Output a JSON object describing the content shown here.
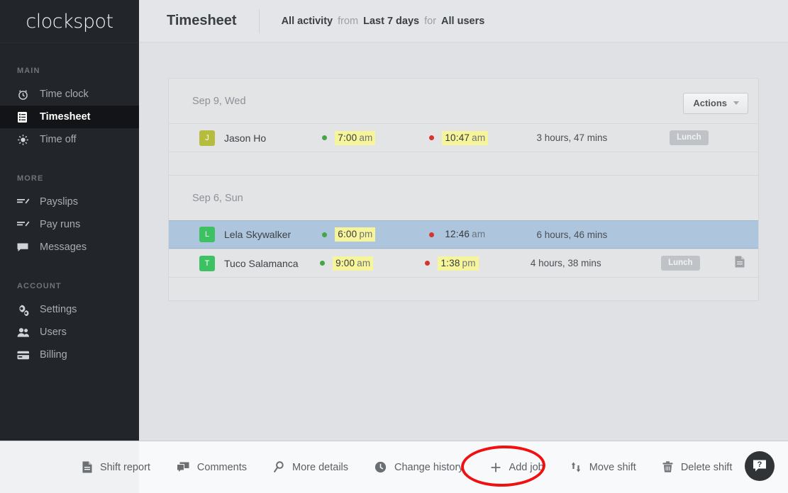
{
  "brand": {
    "name": "clockspot"
  },
  "sidebar": {
    "sections": [
      {
        "label": "MAIN",
        "items": [
          {
            "label": "Time clock",
            "icon": "alarm-clock-icon",
            "active": false
          },
          {
            "label": "Timesheet",
            "icon": "list-document-icon",
            "active": true
          },
          {
            "label": "Time off",
            "icon": "sun-icon",
            "active": false
          }
        ]
      },
      {
        "label": "MORE",
        "items": [
          {
            "label": "Payslips",
            "icon": "payslip-icon",
            "active": false
          },
          {
            "label": "Pay runs",
            "icon": "payslip-icon",
            "active": false
          },
          {
            "label": "Messages",
            "icon": "message-bubble-icon",
            "active": false
          }
        ]
      },
      {
        "label": "ACCOUNT",
        "items": [
          {
            "label": "Settings",
            "icon": "gears-icon",
            "active": false
          },
          {
            "label": "Users",
            "icon": "people-icon",
            "active": false
          },
          {
            "label": "Billing",
            "icon": "credit-card-icon",
            "active": false
          }
        ]
      }
    ],
    "user": {
      "name": "Jason Ho",
      "initial": "J",
      "color": "#b6bd3e"
    }
  },
  "header": {
    "title": "Timesheet",
    "filter": {
      "activity": "All activity",
      "from_label": "from",
      "range": "Last 7 days",
      "for_label": "for",
      "users": "All users"
    }
  },
  "main": {
    "actions_button": "Actions",
    "day_groups": [
      {
        "date_label": "Sep 9, Wed",
        "has_actions": true,
        "shifts": [
          {
            "initial": "J",
            "avatar_color": "#b6bd3e",
            "name": "Jason Ho",
            "clock_in": "7:00",
            "clock_in_meridiem": "am",
            "clock_in_highlight": true,
            "clock_out": "10:47",
            "clock_out_meridiem": "am",
            "clock_out_highlight": true,
            "duration": "3 hours, 47 mins",
            "tag": "Lunch",
            "has_note": false,
            "selected": false
          }
        ]
      },
      {
        "date_label": "Sep 6, Sun",
        "has_actions": false,
        "shifts": [
          {
            "initial": "L",
            "avatar_color": "#3cc163",
            "name": "Lela Skywalker",
            "clock_in": "6:00",
            "clock_in_meridiem": "pm",
            "clock_in_highlight": true,
            "clock_out": "12:46",
            "clock_out_meridiem": "am",
            "clock_out_highlight": false,
            "duration": "6 hours, 46 mins",
            "tag": "",
            "has_note": false,
            "selected": true
          },
          {
            "initial": "T",
            "avatar_color": "#3cc163",
            "name": "Tuco Salamanca",
            "clock_in": "9:00",
            "clock_in_meridiem": "am",
            "clock_in_highlight": true,
            "clock_out": "1:38",
            "clock_out_meridiem": "pm",
            "clock_out_highlight": true,
            "duration": "4 hours, 38 mins",
            "tag": "Lunch",
            "has_note": true,
            "selected": false
          }
        ]
      }
    ]
  },
  "toolbar": {
    "items": [
      {
        "label": "Shift report",
        "icon": "document-icon"
      },
      {
        "label": "Comments",
        "icon": "comment-bubble-icon"
      },
      {
        "label": "More details",
        "icon": "magnifier-icon"
      },
      {
        "label": "Change history",
        "icon": "clock-icon"
      },
      {
        "label": "Add job",
        "icon": "plus-icon"
      },
      {
        "label": "Move shift",
        "icon": "up-down-arrows-icon"
      },
      {
        "label": "Delete shift",
        "icon": "trash-icon"
      }
    ],
    "help_label": "?"
  },
  "colors": {
    "sidebar_bg": "#22252a",
    "sidebar_active_bg": "#121417",
    "page_bg": "#dfe1e4",
    "header_bg": "#e3e5e8",
    "card_bg": "#e2e4e6",
    "selected_row": "#adc5dd",
    "highlight_yellow": "#f6f59b",
    "clock_in_dot": "#46a546",
    "clock_out_dot": "#d9342b",
    "annotation_red": "#f01010"
  }
}
